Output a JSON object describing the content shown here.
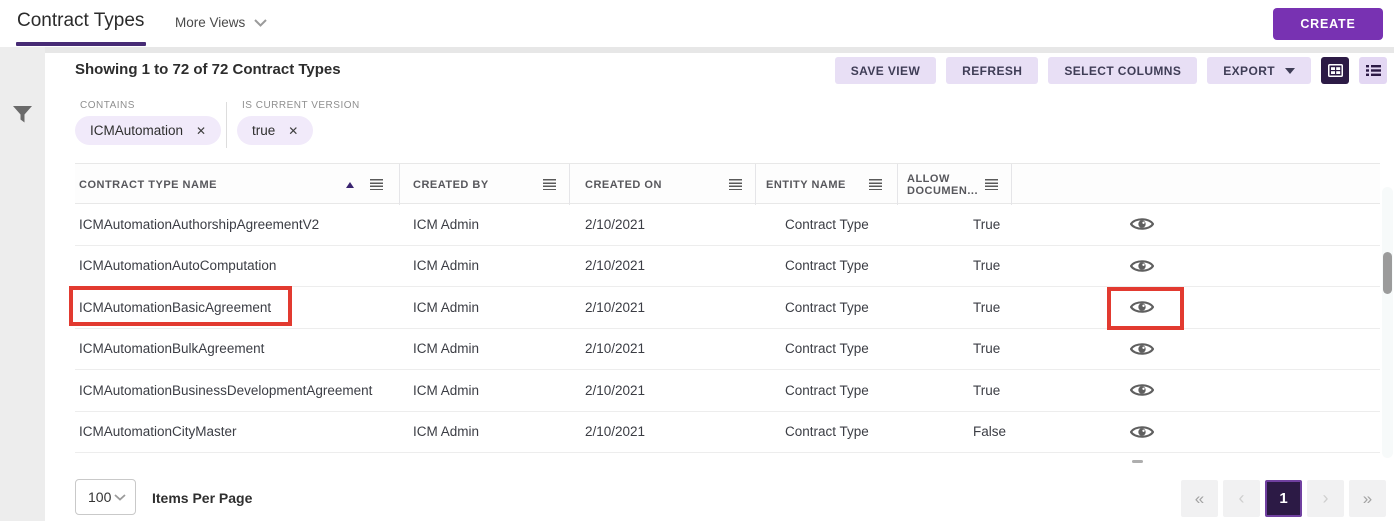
{
  "app": {
    "title": "Contract Types",
    "more_views_label": "More Views",
    "create_label": "CREATE"
  },
  "toolbar": {
    "summary": "Showing 1 to 72 of 72 Contract Types",
    "save_view": "SAVE VIEW",
    "refresh": "REFRESH",
    "select_columns": "SELECT COLUMNS",
    "export": "EXPORT"
  },
  "filters": {
    "items": [
      {
        "label": "CONTAINS",
        "value": "ICMAutomation"
      },
      {
        "label": "IS CURRENT VERSION",
        "value": "true"
      }
    ]
  },
  "table": {
    "columns": [
      {
        "label": "CONTRACT TYPE NAME",
        "sorted": "asc"
      },
      {
        "label": "CREATED BY"
      },
      {
        "label": "CREATED ON"
      },
      {
        "label": "ENTITY NAME"
      },
      {
        "label": "ALLOW DOCUMEN..."
      }
    ],
    "rows": [
      {
        "name": "ICMAutomationAuthorshipAgreementV2",
        "created_by": "ICM Admin",
        "created_on": "2/10/2021",
        "entity_name": "Contract Type",
        "allow_document": "True"
      },
      {
        "name": "ICMAutomationAutoComputation",
        "created_by": "ICM Admin",
        "created_on": "2/10/2021",
        "entity_name": "Contract Type",
        "allow_document": "True"
      },
      {
        "name": "ICMAutomationBasicAgreement",
        "created_by": "ICM Admin",
        "created_on": "2/10/2021",
        "entity_name": "Contract Type",
        "allow_document": "True"
      },
      {
        "name": "ICMAutomationBulkAgreement",
        "created_by": "ICM Admin",
        "created_on": "2/10/2021",
        "entity_name": "Contract Type",
        "allow_document": "True"
      },
      {
        "name": "ICMAutomationBusinessDevelopmentAgreement",
        "created_by": "ICM Admin",
        "created_on": "2/10/2021",
        "entity_name": "Contract Type",
        "allow_document": "True"
      },
      {
        "name": "ICMAutomationCityMaster",
        "created_by": "ICM Admin",
        "created_on": "2/10/2021",
        "entity_name": "Contract Type",
        "allow_document": "False"
      }
    ]
  },
  "footer": {
    "page_size": "100",
    "items_per_page_label": "Items Per Page",
    "current_page": "1",
    "pagination": {
      "first": "«",
      "prev": "‹",
      "next": "›",
      "last": "»"
    }
  },
  "icons": {
    "close": "✕"
  },
  "colors": {
    "accent_purple": "#7832B2",
    "dark_purple": "#2C1A45",
    "tab_underline": "#472B75",
    "annotation_red": "#E23A30",
    "chip_bg": "#F1EAFA",
    "button_bg": "#E8DFF5"
  }
}
